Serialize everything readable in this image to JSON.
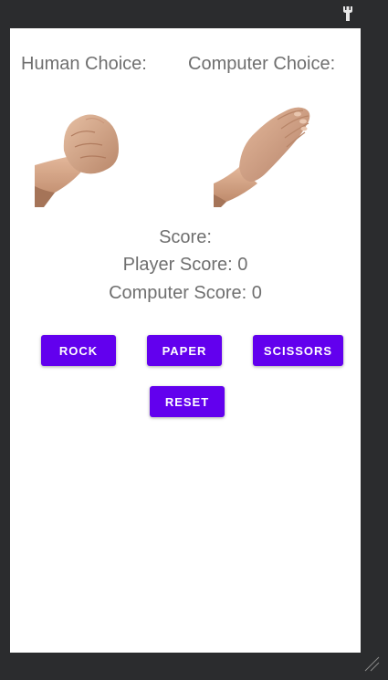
{
  "labels": {
    "human_choice": "Human Choice:",
    "computer_choice": "Computer Choice:"
  },
  "images": {
    "human_hand": "rock-fist-hand-icon",
    "computer_hand": "paper-flat-hand-icon"
  },
  "score": {
    "title": "Score:",
    "player_label": "Player Score: ",
    "player_value": "0",
    "computer_label": "Computer Score: ",
    "computer_value": "0"
  },
  "buttons": {
    "rock": "ROCK",
    "paper": "PAPER",
    "scissors": "SCISSORS",
    "reset": "RESET"
  },
  "colors": {
    "accent": "#6200ee",
    "text": "#6f6f6f",
    "frame": "#2b2c2e",
    "skin": "#d7a98a"
  }
}
